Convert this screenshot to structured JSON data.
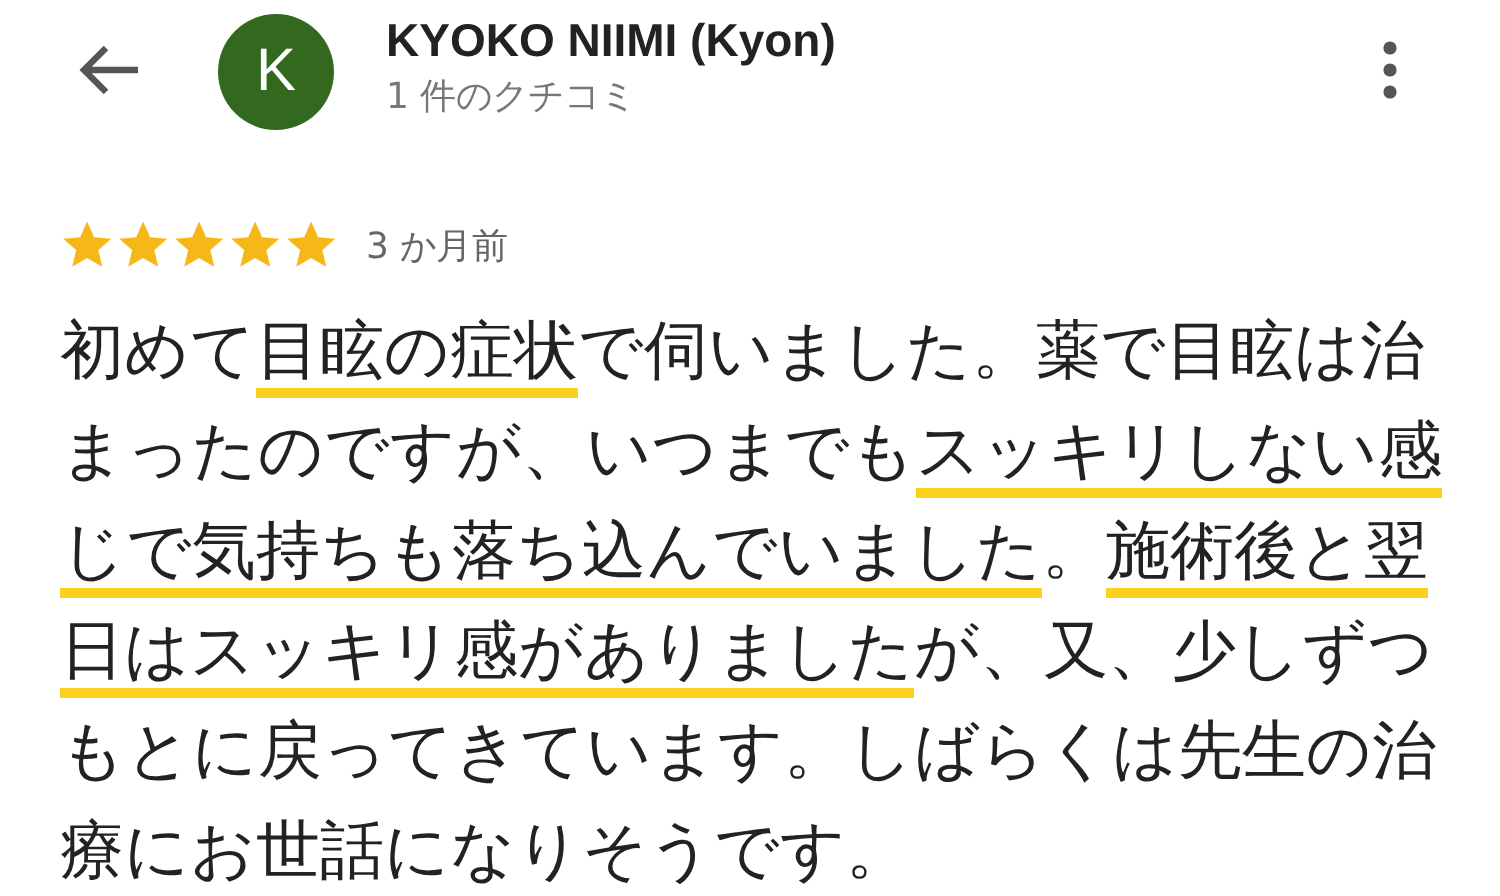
{
  "header": {
    "avatar_letter": "K",
    "name": "KYOKO NIIMI (Kyon)",
    "subtitle": "1 件のクチコミ"
  },
  "review": {
    "stars": 5,
    "time": "3 か月前",
    "segments": [
      {
        "text": "初めて",
        "underlined": false
      },
      {
        "text": "目眩の症状",
        "underlined": true
      },
      {
        "text": "で伺いました。薬で目眩は治まったのですが、いつまでも",
        "underlined": false
      },
      {
        "text": "スッキリしない感じで気持ちも落ち込んでいました",
        "underlined": true
      },
      {
        "text": "。",
        "underlined": false
      },
      {
        "text": "施術後と翌日はスッキリ感がありました",
        "underlined": true
      },
      {
        "text": "が、又、少しずつもとに戻ってきています。しばらくは先生の治療にお世話になりそうです。",
        "underlined": false
      }
    ]
  }
}
